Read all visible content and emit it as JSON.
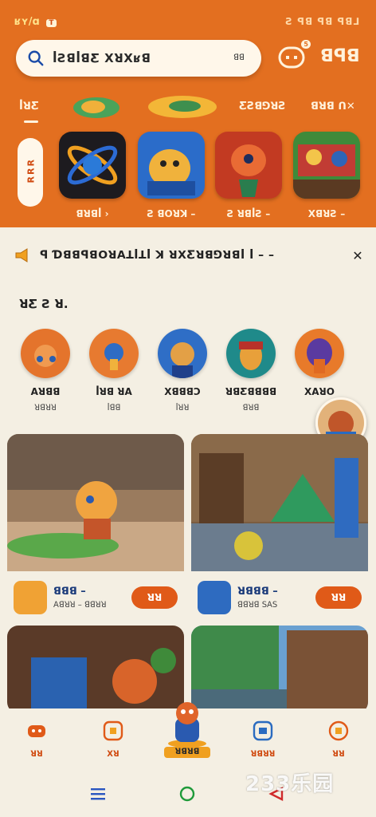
{
  "status_bar": {
    "time": "ʁʏ/ɑ",
    "badge": "ꓔ",
    "indicators": "Ƨ ꟼꓭ ꟼꓭ ꟼꓭ⅃"
  },
  "search": {
    "placeholder": "ꟾƧꓭꟾꓭƸ ꓫꓤꓫʁꓭ",
    "count": "ꓭꓭ"
  },
  "header": {
    "message_badge": "5",
    "profile_label": "ꓭꟼꓭ"
  },
  "categories": [
    {
      "label": "ꟾꓤƸ"
    },
    {
      "label": "ƸƧꓭ⅁ꓤƧ"
    },
    {
      "label": "ꓭꓤꓭ ꓵ✕"
    }
  ],
  "side_tag": {
    "label": "ꓤꓤꓤ"
  },
  "featured_games": [
    {
      "name": "ꓭꓤꓭꟾ ›"
    },
    {
      "name": "Ƨ ꓭꓳꓤꓘ –"
    },
    {
      "name": "Ƨ ꓤꓭꟾƧ –"
    },
    {
      "name": "ꓫꓭꓤƧ –"
    }
  ],
  "notice": {
    "text": "ꟼ Ɗꓭꓭꟼꓭꓳꓤꓮꓕꟾꓕꟾ ꓘ ꓤꓫƸꓤꓭ⅁ꓤꓭꟾ ꟾ – –"
  },
  "section": {
    "title": "ꓤƸ Ƨ ꓤ."
  },
  "creators": [
    {
      "name": "ꓮꓤꓭꓭ",
      "sub": "ꓤꓭꓤꓤ"
    },
    {
      "name": "ꟾꓤꓭ ꓤꓮ",
      "sub": "ꟾꓭꓭ"
    },
    {
      "name": "ꓫꓭꓭꓭꓛ",
      "sub": "ꟾꓤꓤ"
    },
    {
      "name": "ꓤꓭƸꓭꓭꓭꓭ",
      "sub": "ꓭꓤꓭ"
    },
    {
      "name": "ꓫꓮꓤꓳ",
      "sub": ""
    }
  ],
  "game_cards": [
    {
      "name": "ꓭꓭꓭ –",
      "tag": "ꓮꓭꓤꓤ – ꓭꓭꓤꓤ",
      "button": "ꓤꓤ"
    },
    {
      "name": "ꓤꓭꓭꓭ –",
      "tag": "ꓭꓭꓤꓭ ꓢꓮꓢ",
      "button": "ꓤꓤ"
    }
  ],
  "tabs": [
    {
      "label": "ꓤꓤ"
    },
    {
      "label": "ꓫꓤ"
    },
    {
      "label": "ꓤꓭꓤꓤ"
    },
    {
      "label": "ꓤꓤ"
    }
  ],
  "center_tab": {
    "label": "ꓤꓭꓤꓭ"
  },
  "watermark": {
    "text": "233乐园"
  },
  "colors": {
    "header_orange": "#e36f20",
    "accent": "#e05a18",
    "background": "#f4efe3",
    "link_blue": "#1a3a7a"
  }
}
